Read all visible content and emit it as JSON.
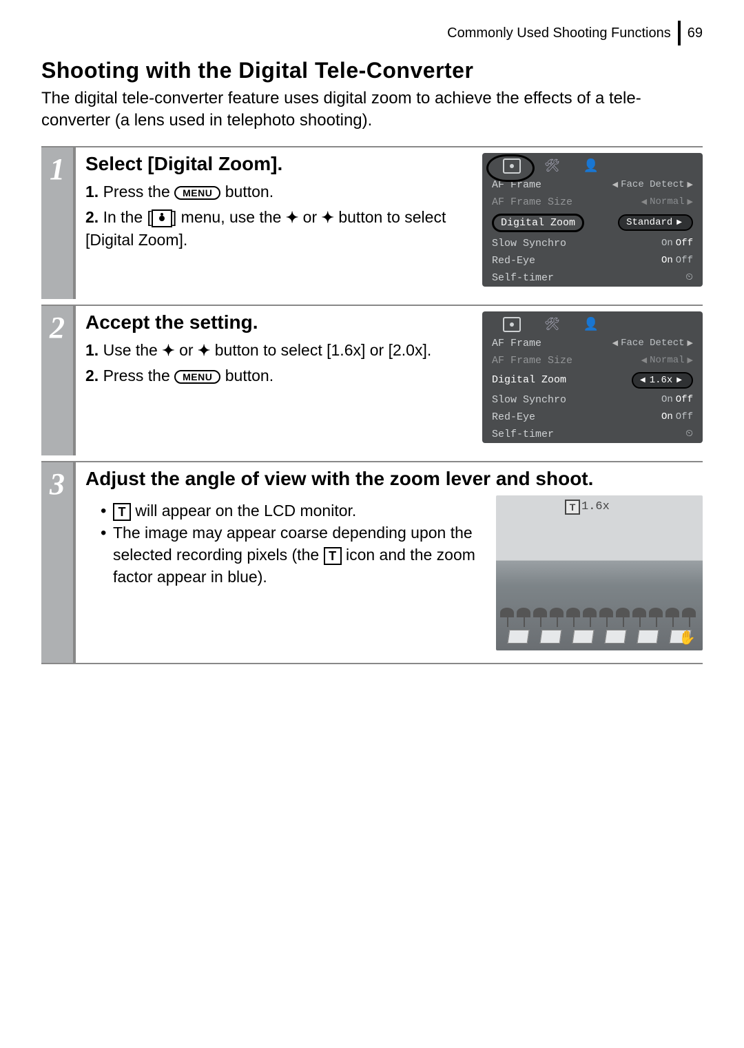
{
  "header": {
    "section": "Commonly Used Shooting Functions",
    "page": "69"
  },
  "title": "Shooting with the Digital Tele-Converter",
  "intro": "The digital tele-converter feature uses digital zoom to achieve the effects of a tele-converter (a lens used in telephoto shooting).",
  "icons": {
    "menu": "MENU",
    "t": "T"
  },
  "steps": [
    {
      "num": "1",
      "title": "Select [Digital Zoom].",
      "subs": [
        {
          "n": "1.",
          "a": "Press the ",
          "b": " button."
        },
        {
          "n": "2.",
          "a": "In the [",
          "b": "] menu, use the ",
          "c": " or ",
          "d": " button to select [Digital Zoom]."
        }
      ],
      "lcd": {
        "rows": [
          {
            "label": "AF Frame",
            "val": "Face Detect",
            "arrows": true
          },
          {
            "label": "AF Frame Size",
            "val": "Normal",
            "arrows": true,
            "dim": true
          },
          {
            "label": "Digital Zoom",
            "val": "Standard",
            "hl": true
          },
          {
            "label": "Slow Synchro",
            "on": "On",
            "off": "Off",
            "active": "off"
          },
          {
            "label": "Red-Eye",
            "on": "On",
            "off": "Off",
            "active": "on"
          },
          {
            "label": "Self-timer",
            "symbol": "⏲"
          }
        ]
      }
    },
    {
      "num": "2",
      "title": "Accept the setting.",
      "subs": [
        {
          "n": "1.",
          "a": "Use the ",
          "b": " or ",
          "c": " button to select [1.6x] or [2.0x]."
        },
        {
          "n": "2.",
          "a": "Press the ",
          "b": " button."
        }
      ],
      "lcd": {
        "rows": [
          {
            "label": "AF Frame",
            "val": "Face Detect",
            "arrows": true
          },
          {
            "label": "AF Frame Size",
            "val": "Normal",
            "arrows": true,
            "dim": true
          },
          {
            "label": "Digital Zoom",
            "val": "1.6x",
            "hlval": true
          },
          {
            "label": "Slow Synchro",
            "on": "On",
            "off": "Off",
            "active": "off"
          },
          {
            "label": "Red-Eye",
            "on": "On",
            "off": "Off",
            "active": "on"
          },
          {
            "label": "Self-timer",
            "symbol": "⏲"
          }
        ]
      }
    },
    {
      "num": "3",
      "title": "Adjust the angle of view with the zoom lever and shoot.",
      "bullets": [
        {
          "a": "",
          "b": " will appear on the LCD monitor."
        },
        {
          "a": "The image may appear coarse depending upon the selected recording pixels (the ",
          "b": " icon and the zoom factor appear in blue)."
        }
      ],
      "photo": {
        "t": "T",
        "zoom": "1.6x"
      }
    }
  ]
}
